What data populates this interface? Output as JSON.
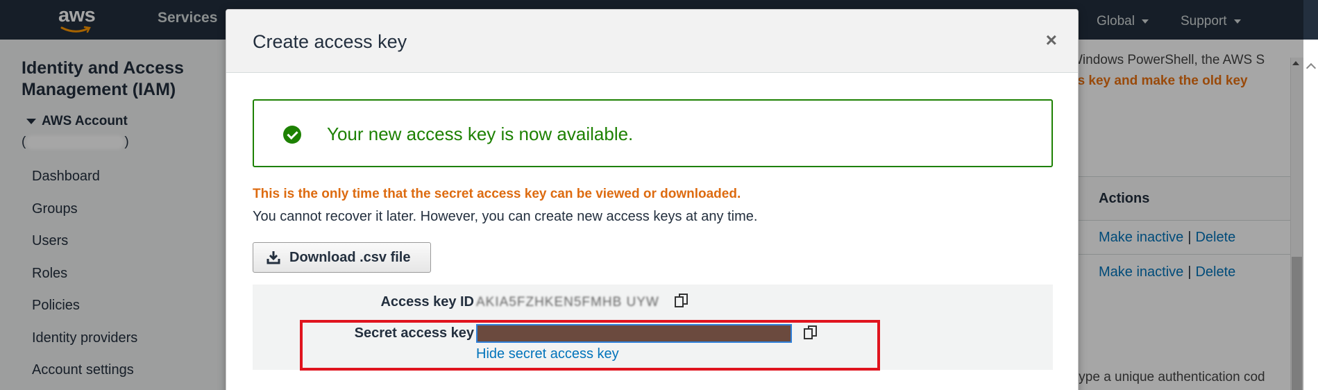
{
  "topnav": {
    "logo_text": "aws",
    "services_label": "Services",
    "global_label": "Global",
    "support_label": "Support"
  },
  "sidebar": {
    "title": "Identity and Access Management (IAM)",
    "account_label": "AWS Account",
    "account_id_open": "(",
    "account_id_close": ")",
    "items": [
      {
        "label": "Dashboard"
      },
      {
        "label": "Groups"
      },
      {
        "label": "Users"
      },
      {
        "label": "Roles"
      },
      {
        "label": "Policies"
      },
      {
        "label": "Identity providers"
      },
      {
        "label": "Account settings"
      }
    ]
  },
  "background": {
    "text1": "Windows PowerShell, the AWS S",
    "text2": "ss key and make the old key",
    "actions_header": "Actions",
    "rows": [
      {
        "make_inactive": "Make inactive",
        "separator": "|",
        "delete": "Delete"
      },
      {
        "make_inactive": "Make inactive",
        "separator": "|",
        "delete": "Delete"
      }
    ],
    "text3": "type a unique authentication cod"
  },
  "modal": {
    "title": "Create access key",
    "close_symbol": "×",
    "success_message": "Your new access key is now available.",
    "warning": "This is the only time that the secret access key can be viewed or downloaded.",
    "info": "You cannot recover it later. However, you can create new access keys at any time.",
    "download_button": "Download .csv file",
    "access_key_id_label": "Access key ID",
    "access_key_id_value": "AKIA5FZHKEN5FMHB UYW",
    "secret_access_key_label": "Secret access key",
    "hide_secret_link": "Hide secret access key"
  },
  "colors": {
    "nav_bg": "#232f3e",
    "success_green": "#1d8102",
    "warning_orange": "#dd6b10",
    "link_blue": "#0073bb",
    "highlight_red": "#e0141e",
    "secret_redacted": "#6b4a3e"
  }
}
